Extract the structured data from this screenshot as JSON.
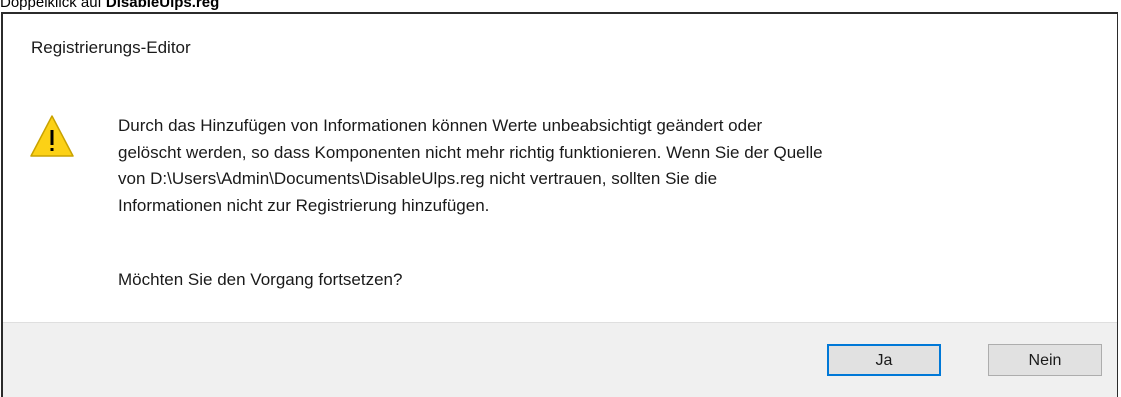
{
  "caption": {
    "prefix": "Doppelklick auf ",
    "file": "DisableUlps.reg"
  },
  "dialog": {
    "title": "Registrierungs-Editor",
    "icon": "warning-icon",
    "message_lines": [
      "Durch das Hinzufügen von Informationen können Werte unbeabsichtigt geändert oder",
      "gelöscht werden, so dass Komponenten nicht mehr richtig funktionieren. Wenn Sie der Quelle",
      "von D:\\Users\\Admin\\Documents\\DisableUlps.reg nicht vertrauen, sollten Sie die",
      "Informationen nicht zur Registrierung hinzufügen."
    ],
    "question": "Möchten Sie den Vorgang fortsetzen?",
    "buttons": {
      "yes": "Ja",
      "no": "Nein"
    },
    "colors": {
      "warning_fill": "#fcd116",
      "warning_outline": "#c9a200",
      "default_button_border": "#0078d7",
      "footer_bg": "#f0f0f0"
    }
  }
}
